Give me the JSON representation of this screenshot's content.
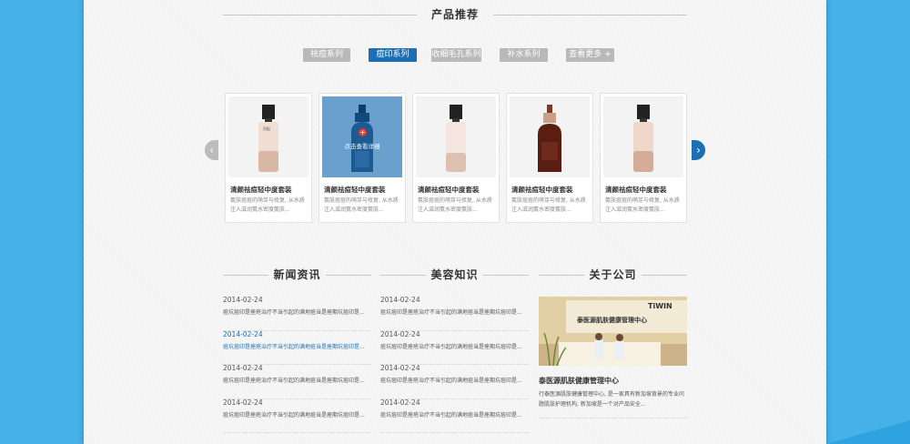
{
  "products": {
    "title": "产品推荐",
    "tabs": [
      {
        "label": "祛痘系列",
        "active": false
      },
      {
        "label": "痘印系列",
        "active": true
      },
      {
        "label": "收细毛孔系列",
        "active": false
      },
      {
        "label": "补水系列",
        "active": false
      },
      {
        "label": "查看更多 +",
        "active": false
      }
    ],
    "items": [
      {
        "name": "清颜祛痘轻中度套装",
        "desc": "氨肤痘痘的萌芽与修复, 从水质注入滋润氨水密度氨肤..."
      },
      {
        "name": "清颜祛痘轻中度套装",
        "desc": "氨肤痘痘的萌芽与修复, 从水质注入滋润氨水密度氨肤...",
        "overlay": "点击查看详细"
      },
      {
        "name": "清颜祛痘轻中度套装",
        "desc": "氨肤痘痘的萌芽与修复, 从水质注入滋润氨水密度氨肤..."
      },
      {
        "name": "清颜祛痘轻中度套装",
        "desc": "氨肤痘痘的萌芽与修复, 从水质注入滋润氨水密度氨肤..."
      },
      {
        "name": "清颜祛痘轻中度套装",
        "desc": "氨肤痘痘的萌芽与修复, 从水质注入滋润氨水密度氨肤..."
      }
    ],
    "brand_mark": "烈配"
  },
  "news": {
    "title": "新闻资讯",
    "items": [
      {
        "date": "2014-02-24",
        "text": "痘坑痘印是痤疮治疗不当引起的满地痘当是痤期坑痘印是...",
        "highlight": false
      },
      {
        "date": "2014-02-24",
        "text": "痘坑痘印是痤疮治疗不当引起的满地痘当是痤期坑痘印是...",
        "highlight": true
      },
      {
        "date": "2014-02-24",
        "text": "痘坑痘印是痤疮治疗不当引起的满地痘当是痤期坑痘印是...",
        "highlight": false
      },
      {
        "date": "2014-02-24",
        "text": "痘坑痘印是痤疮治疗不当引起的满地痘当是痤期坑痘印是...",
        "highlight": false
      }
    ]
  },
  "beauty": {
    "title": "美容知识",
    "items": [
      {
        "date": "2014-02-24",
        "text": "痘坑痘印是痤疮治疗不当引起的满地痘当是痤期坑痘印是..."
      },
      {
        "date": "2014-02-24",
        "text": "痘坑痘印是痤疮治疗不当引起的满地痘当是痤期坑痘印是..."
      },
      {
        "date": "2014-02-24",
        "text": "痘坑痘印是痤疮治疗不当引起的满地痘当是痤期坑痘印是..."
      },
      {
        "date": "2014-02-24",
        "text": "痘坑痘印是痤疮治疗不当引起的满地痘当是痤期坑痘印是..."
      }
    ]
  },
  "about": {
    "title": "关于公司",
    "photo_sign": "泰医源肌肤健康管理中心",
    "photo_logo": "TiWIN",
    "company": "泰医源肌肤健康管理中心",
    "text": "行泰医源肌肤健康管理中心, 是一家具有新加坡背景的专业问题肌肤护理机构, 新加坡是一个对产品安全..."
  },
  "colors": {
    "accent": "#1c6fb5",
    "page_bg": "#46b1e6"
  }
}
